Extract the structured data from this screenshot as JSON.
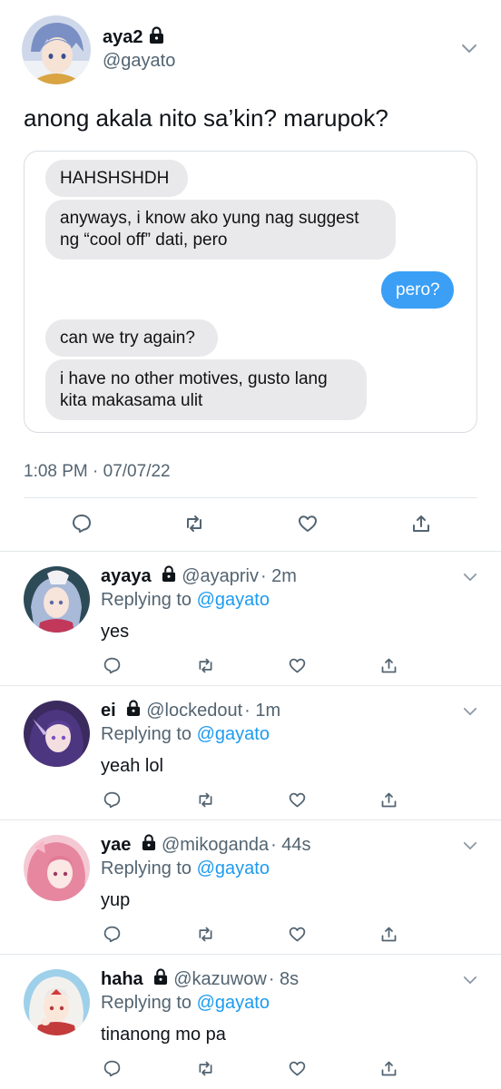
{
  "main_tweet": {
    "display_name": "aya2",
    "handle": "@gayato",
    "text": "anong akala nito sa’kin? marupok?",
    "timestamp": "1:08 PM · 07/07/22",
    "messages": [
      {
        "side": "in",
        "text": "HAHSHSHDH"
      },
      {
        "side": "in",
        "text": "anyways, i know ako yung nag suggest ng “cool off” dati, pero"
      },
      {
        "side": "out",
        "text": "pero?"
      },
      {
        "side": "in",
        "text": "can we try again?"
      },
      {
        "side": "in",
        "text": "i have no other motives, gusto lang kita makasama ulit"
      }
    ],
    "actions": [
      "reply-icon",
      "retweet-icon",
      "like-icon",
      "share-icon"
    ]
  },
  "replies": [
    {
      "name": "ayaya",
      "handle": "@ayapriv",
      "time": "· 2m",
      "replying_label": "Replying to",
      "mention": "@gayato",
      "text": "yes"
    },
    {
      "name": "ei",
      "handle": "@lockedout",
      "time": "· 1m",
      "replying_label": "Replying to",
      "mention": "@gayato",
      "text": "yeah lol"
    },
    {
      "name": "yae",
      "handle": "@mikoganda",
      "time": "· 44s",
      "replying_label": "Replying to",
      "mention": "@gayato",
      "text": "yup"
    },
    {
      "name": "haha",
      "handle": "@kazuwow",
      "time": "· 8s",
      "replying_label": "Replying to",
      "mention": "@gayato",
      "text": "tinanong mo pa"
    }
  ],
  "colors": {
    "accent": "#1d9bf0",
    "secondary_text": "#536471",
    "bubble_in": "#e9e9eb",
    "bubble_out": "#3a9ff5"
  }
}
